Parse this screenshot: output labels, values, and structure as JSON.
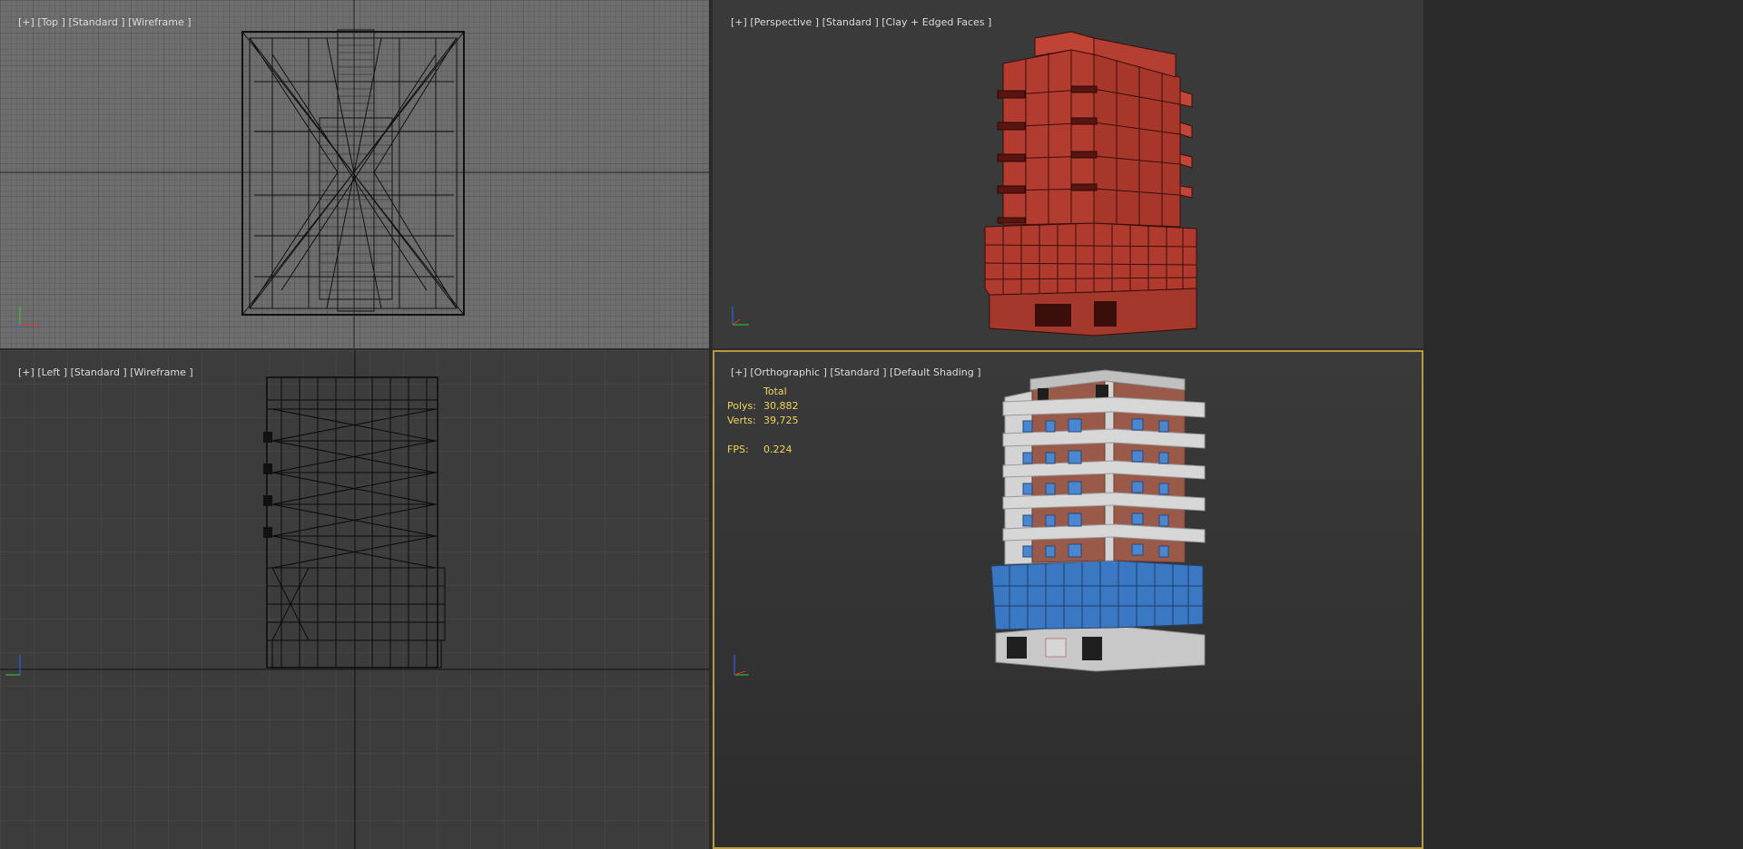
{
  "viewports": {
    "top": {
      "bracket": "[+]",
      "view": "[Top ]",
      "standard": "[Standard ]",
      "shading": "[Wireframe ]"
    },
    "perspective": {
      "bracket": "[+]",
      "view": "[Perspective ]",
      "standard": "[Standard ]",
      "shading": "[Clay + Edged Faces ]"
    },
    "left": {
      "bracket": "[+]",
      "view": "[Left ]",
      "standard": "[Standard ]",
      "shading": "[Wireframe ]"
    },
    "orthographic": {
      "bracket": "[+]",
      "view": "[Orthographic ]",
      "standard": "[Standard ]",
      "shading": "[Default Shading ]"
    }
  },
  "statistics": {
    "header": "Total",
    "polys_label": "Polys:",
    "polys_value": "30,882",
    "verts_label": "Verts:",
    "verts_value": "39,725",
    "fps_label": "FPS:",
    "fps_value": "0.224"
  },
  "colors": {
    "active_border": "#b89a45",
    "clay_red": "#b03a2e",
    "glass_blue": "#3b78c4",
    "brick": "#9a5a4a",
    "axis_x": "#d33",
    "axis_y": "#3c3",
    "axis_z": "#36f"
  },
  "icons": [
    "axis-tripod-icon"
  ]
}
